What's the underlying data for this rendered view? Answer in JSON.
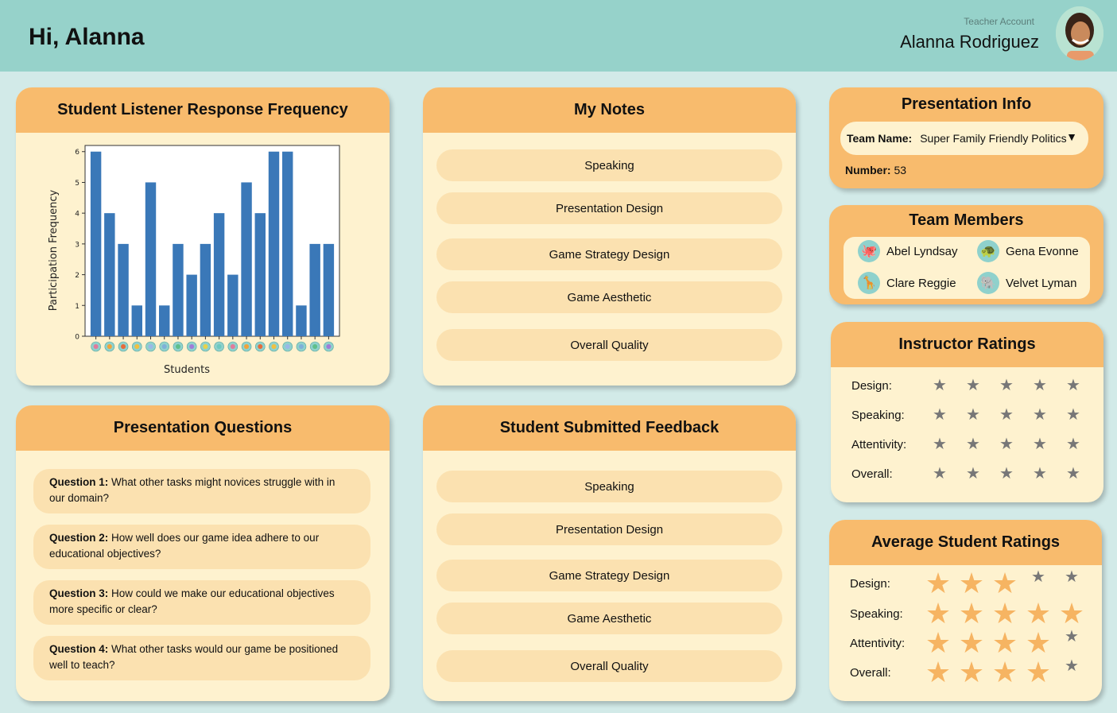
{
  "header": {
    "greeting": "Hi, Alanna",
    "account_type": "Teacher Account",
    "user_name": "Alanna Rodriguez"
  },
  "colors": {
    "bar": "#3a78b8",
    "card_header": "#f8bb6d",
    "card_body": "#fef2cf",
    "pill": "#fbe1b0",
    "star_gold": "#f6b462",
    "star_grey": "#777777",
    "topbar": "#96d2ca",
    "background": "#d2eae8"
  },
  "chart_card": {
    "title": "Student Listener Response Frequency"
  },
  "chart_data": {
    "type": "bar",
    "categories": [
      "student-1",
      "student-2",
      "student-3",
      "student-4",
      "student-5",
      "student-6",
      "student-7",
      "student-8",
      "student-9",
      "student-10",
      "student-11",
      "student-12",
      "student-13",
      "student-14",
      "student-15",
      "student-16",
      "student-17",
      "student-18"
    ],
    "values": [
      6,
      4,
      3,
      1,
      5,
      1,
      3,
      2,
      3,
      4,
      2,
      5,
      4,
      6,
      6,
      1,
      3,
      3
    ],
    "title": "",
    "xlabel": "Students",
    "ylabel": "Participation Frequency",
    "ylim": [
      0,
      6.2
    ],
    "yticks": [
      "0",
      "1",
      "2",
      "3",
      "4",
      "5",
      "6"
    ],
    "x_tick_style": "student avatar icons",
    "grid": false
  },
  "notes": {
    "title": "My Notes",
    "items": [
      "Speaking",
      "Presentation Design",
      "Game Strategy Design",
      "Game Aesthetic",
      "Overall Quality"
    ]
  },
  "questions": {
    "title": "Presentation Questions",
    "items": [
      {
        "label": "Question 1:",
        "text_line1": "What other tasks might novices struggle with in",
        "text_line2": "our domain?"
      },
      {
        "label": "Question 2:",
        "text_line1": "How well does our game idea adhere to our",
        "text_line2": "educational objectives?"
      },
      {
        "label": "Question 3:",
        "text_line1": "How could we make our educational objectives",
        "text_line2": "more specific or clear?"
      },
      {
        "label": "Question 4:",
        "text_line1": "What other tasks would our game be positioned",
        "text_line2": "well to teach?"
      }
    ]
  },
  "feedback": {
    "title": "Student Submitted Feedback",
    "items": [
      "Speaking",
      "Presentation Design",
      "Game Strategy Design",
      "Game Aesthetic",
      "Overall Quality"
    ]
  },
  "presentation_info": {
    "title": "Presentation Info",
    "team_label": "Team Name:",
    "team_value": "Super Family Friendly Politics",
    "number_label": "Number:",
    "number_value": "53"
  },
  "team_members": {
    "title": "Team Members",
    "members": [
      {
        "name": "Abel Lyndsay",
        "icon": "octopus-icon"
      },
      {
        "name": "Gena Evonne",
        "icon": "turtle-icon"
      },
      {
        "name": "Clare Reggie",
        "icon": "giraffe-icon"
      },
      {
        "name": "Velvet Lyman",
        "icon": "elephant-icon"
      }
    ]
  },
  "instructor_ratings": {
    "title": "Instructor Ratings",
    "rows": [
      {
        "label": "Design:",
        "rating": 0
      },
      {
        "label": "Speaking:",
        "rating": 0
      },
      {
        "label": "Attentivity:",
        "rating": 0
      },
      {
        "label": "Overall:",
        "rating": 0
      }
    ]
  },
  "student_ratings": {
    "title": "Average Student Ratings",
    "rows": [
      {
        "label": "Design:",
        "rating": 3
      },
      {
        "label": "Speaking:",
        "rating": 5
      },
      {
        "label": "Attentivity:",
        "rating": 4
      },
      {
        "label": "Overall:",
        "rating": 4
      }
    ]
  }
}
